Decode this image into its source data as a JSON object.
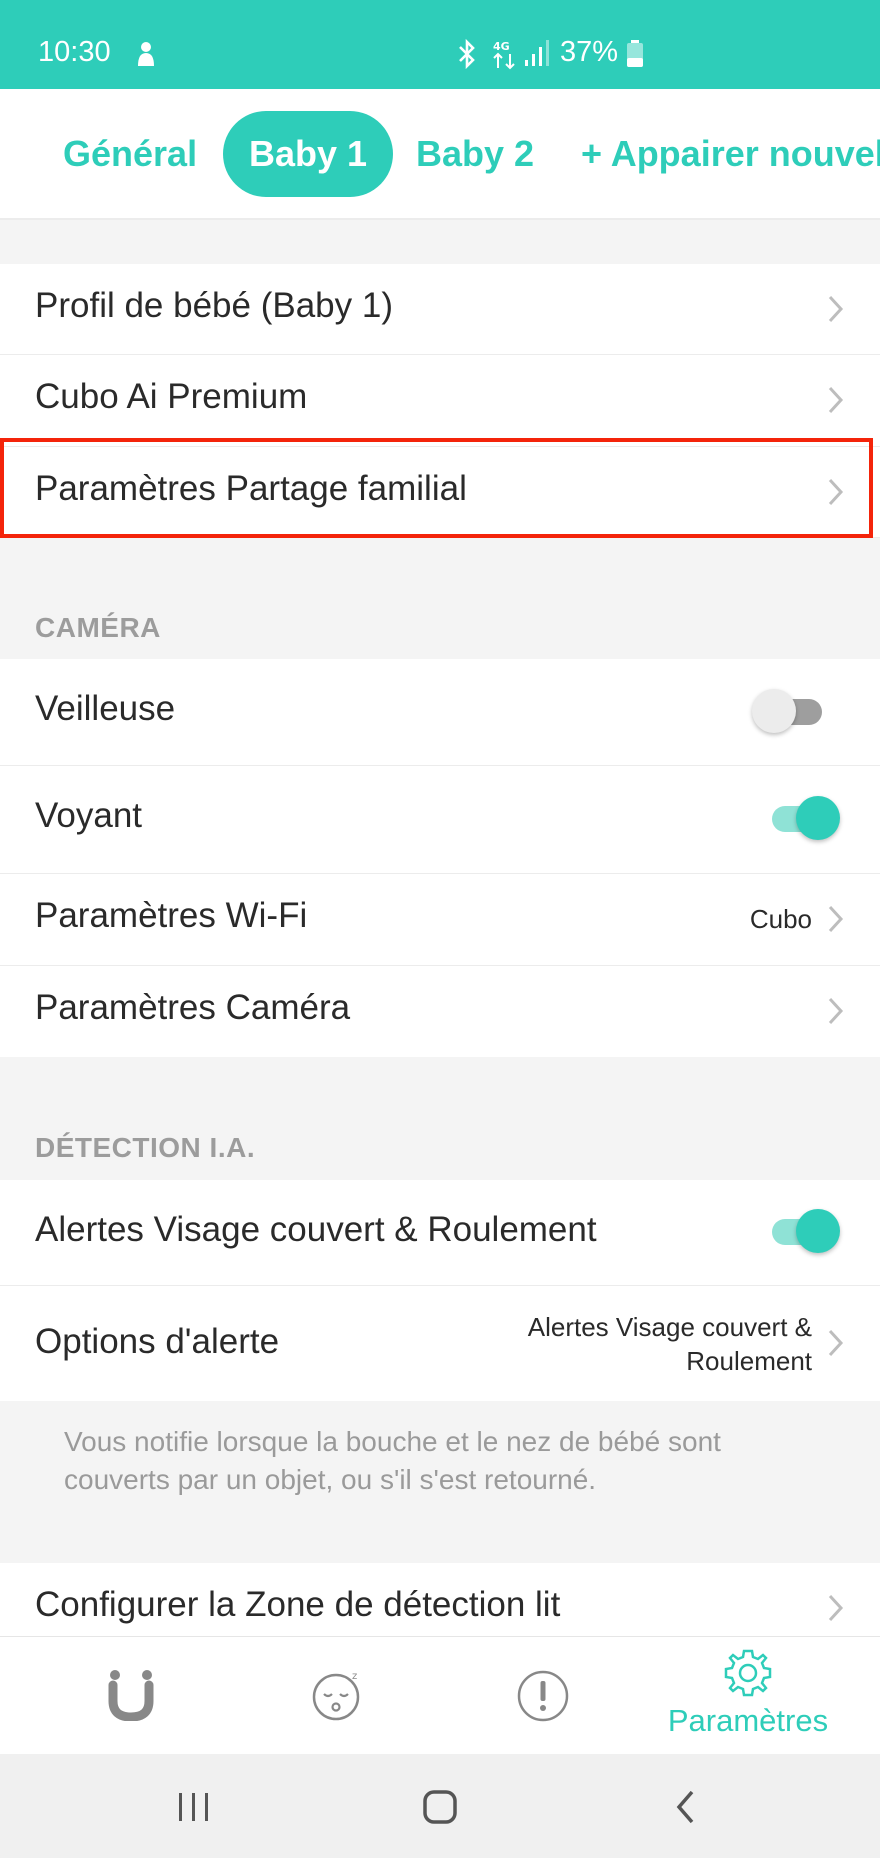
{
  "status_bar": {
    "time": "10:30",
    "battery": "37%"
  },
  "tabs": [
    {
      "label": "Général"
    },
    {
      "label": "Baby 1"
    },
    {
      "label": "Baby 2"
    },
    {
      "label": "+ Appairer nouvel"
    }
  ],
  "rows_top": [
    {
      "label": "Profil de bébé (Baby 1)"
    },
    {
      "label": "Cubo Ai Premium"
    },
    {
      "label": "Paramètres Partage familial"
    }
  ],
  "camera": {
    "title": "CAMÉRA",
    "veilleuse": {
      "label": "Veilleuse",
      "on": false
    },
    "voyant": {
      "label": "Voyant",
      "on": true
    },
    "wifi": {
      "label": "Paramètres Wi-Fi",
      "value": "Cubo"
    },
    "camera_settings": {
      "label": "Paramètres Caméra"
    }
  },
  "detection": {
    "title": "DÉTECTION I.A.",
    "alerts": {
      "label": "Alertes Visage couvert & Roulement",
      "on": true
    },
    "options": {
      "label": "Options d'alerte",
      "value_line1": "Alertes Visage couvert &",
      "value_line2": "Roulement"
    },
    "note": "Vous notifie lorsque la bouche et le nez de bébé sont couverts par un objet, ou s'il s'est retourné.",
    "zone": {
      "label": "Configurer la Zone de détection lit"
    }
  },
  "bottom_tabs": {
    "settings_label": "Paramètres"
  },
  "colors": {
    "accent": "#2ecdb9",
    "highlight": "#f4240a"
  }
}
